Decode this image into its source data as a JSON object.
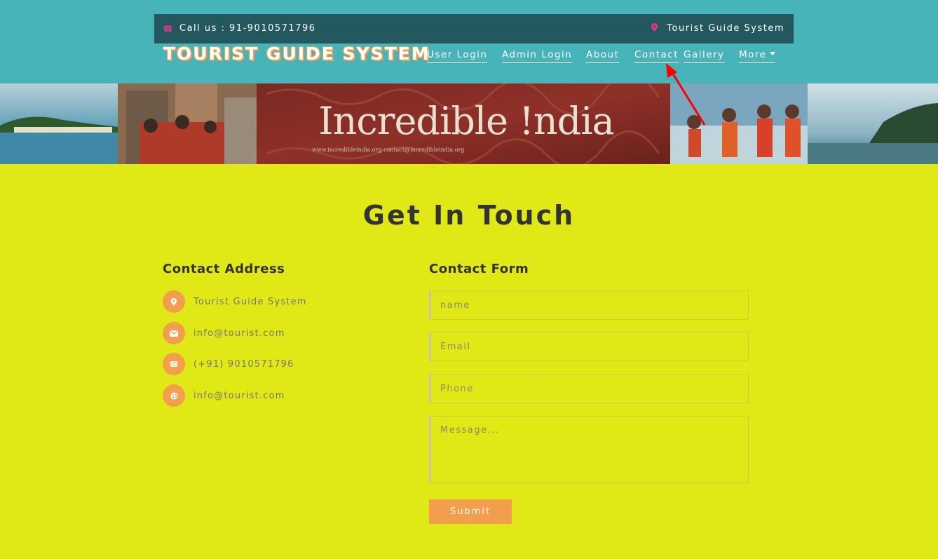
{
  "topbar": {
    "call_label": "Call us : 91-9010571796",
    "site_label": "Tourist Guide System"
  },
  "brand": "TOURIST GUIDE SYSTEM",
  "nav": {
    "user_login": "User Login",
    "admin_login": "Admin Login",
    "about": "About",
    "contact": "Contact",
    "gallery": "Gallery",
    "more": "More"
  },
  "banner": {
    "heading": "Incredible !ndia",
    "sub": "www.incredibleindia.org    contact@incredibleindia.org"
  },
  "main": {
    "title": "Get In Touch",
    "address_heading": "Contact Address",
    "form_heading": "Contact Form"
  },
  "address": {
    "location": "Tourist Guide System",
    "email": "info@tourist.com",
    "phone": "(+91) 9010571796",
    "web": "info@tourist.com"
  },
  "form": {
    "name_placeholder": "name",
    "email_placeholder": "Email",
    "phone_placeholder": "Phone",
    "message_placeholder": "Message...",
    "submit_label": "Submit"
  },
  "colors": {
    "header_bg": "#46b4b9",
    "topbar_bg": "#23595e",
    "page_bg": "#e0e916",
    "accent": "#f29e4c",
    "pin_icon": "#e0368a",
    "annotation_arrow": "#ff0000"
  },
  "icons": [
    "phone-icon",
    "map-pin-icon",
    "envelope-icon",
    "globe-icon",
    "chevron-down-icon"
  ]
}
